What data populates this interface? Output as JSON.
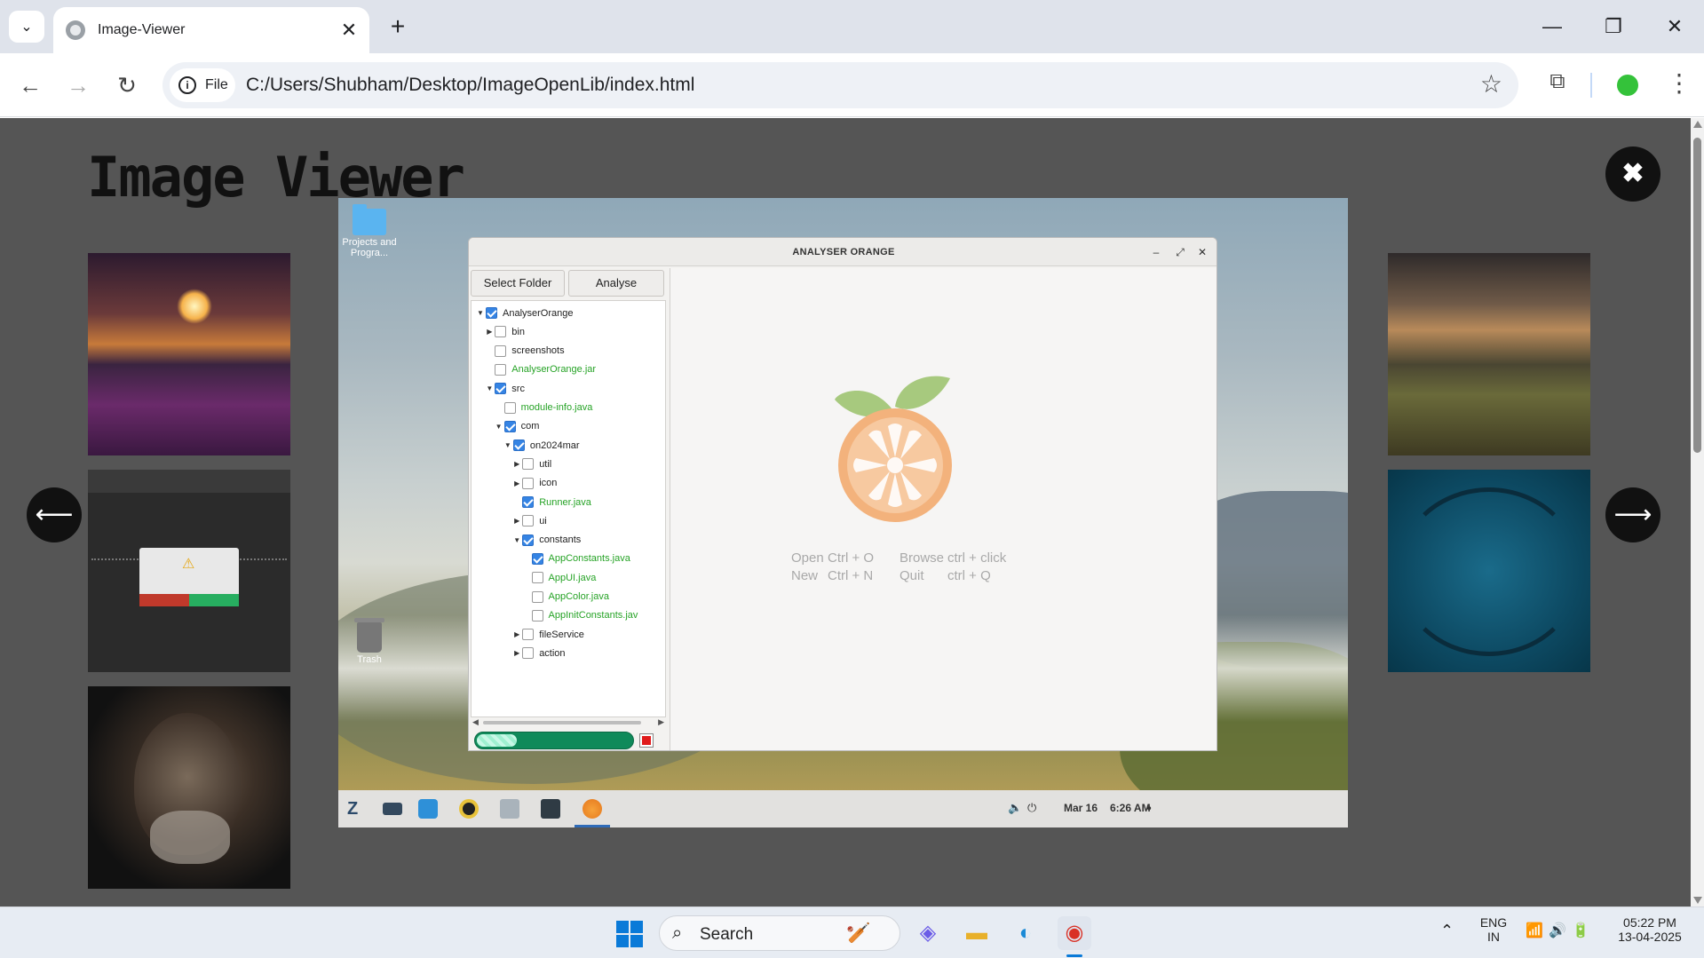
{
  "browser": {
    "tab_title": "Image-Viewer",
    "url": "C:/Users/Shubham/Desktop/ImageOpenLib/index.html",
    "security_chip": "File"
  },
  "page": {
    "title": "Image Viewer",
    "prev_label": "⟵",
    "next_label": "⟶",
    "close_label": "✖"
  },
  "modal_screenshot": {
    "desktop_icons": [
      {
        "label": "Projects and Progra..."
      },
      {
        "label": "Trash"
      }
    ],
    "app": {
      "title": "ANALYSER ORANGE",
      "buttons": {
        "select_folder": "Select Folder",
        "analyse": "Analyse"
      },
      "tree": [
        {
          "label": "AnalyserOrange",
          "level": 0,
          "arrow": "down",
          "checked": true,
          "file": false
        },
        {
          "label": "bin",
          "level": 1,
          "arrow": "right",
          "checked": false,
          "file": false
        },
        {
          "label": "screenshots",
          "level": 1,
          "arrow": "",
          "checked": false,
          "file": false
        },
        {
          "label": "AnalyserOrange.jar",
          "level": 1,
          "arrow": "",
          "checked": false,
          "file": true
        },
        {
          "label": "src",
          "level": 1,
          "arrow": "down",
          "checked": true,
          "file": false
        },
        {
          "label": "module-info.java",
          "level": 2,
          "arrow": "",
          "checked": false,
          "file": true
        },
        {
          "label": "com",
          "level": 2,
          "arrow": "down",
          "checked": true,
          "file": false
        },
        {
          "label": "on2024mar",
          "level": 3,
          "arrow": "down",
          "checked": true,
          "file": false
        },
        {
          "label": "util",
          "level": 4,
          "arrow": "right",
          "checked": false,
          "file": false
        },
        {
          "label": "icon",
          "level": 4,
          "arrow": "right",
          "checked": false,
          "file": false
        },
        {
          "label": "Runner.java",
          "level": 4,
          "arrow": "",
          "checked": true,
          "file": true
        },
        {
          "label": "ui",
          "level": 4,
          "arrow": "right",
          "checked": false,
          "file": false
        },
        {
          "label": "constants",
          "level": 4,
          "arrow": "down",
          "checked": true,
          "file": false
        },
        {
          "label": "AppConstants.java",
          "level": 5,
          "arrow": "",
          "checked": true,
          "file": true
        },
        {
          "label": "AppUI.java",
          "level": 5,
          "arrow": "",
          "checked": false,
          "file": true
        },
        {
          "label": "AppColor.java",
          "level": 5,
          "arrow": "",
          "checked": false,
          "file": true
        },
        {
          "label": "AppInitConstants.jav",
          "level": 5,
          "arrow": "",
          "checked": false,
          "file": true
        },
        {
          "label": "fileService",
          "level": 4,
          "arrow": "right",
          "checked": false,
          "file": false
        },
        {
          "label": "action",
          "level": 4,
          "arrow": "right",
          "checked": false,
          "file": false
        }
      ],
      "progress": 0.25,
      "shortcuts": {
        "open": "Open",
        "open_key": "Ctrl + O",
        "new": "New",
        "new_key": "Ctrl + N",
        "browse": "Browse",
        "browse_key": "ctrl + click",
        "quit": "Quit",
        "quit_key": "ctrl + Q"
      }
    },
    "dock": {
      "date": "Mar 16",
      "time": "6:26 AM"
    }
  },
  "taskbar": {
    "search_placeholder": "Search",
    "lang_top": "ENG",
    "lang_bottom": "IN",
    "time": "05:22 PM",
    "date": "13-04-2025"
  },
  "colors": {
    "accent": "#3584e4",
    "file_green": "#26a326",
    "progress": "#0f8a5a",
    "overlay": "#555555"
  }
}
